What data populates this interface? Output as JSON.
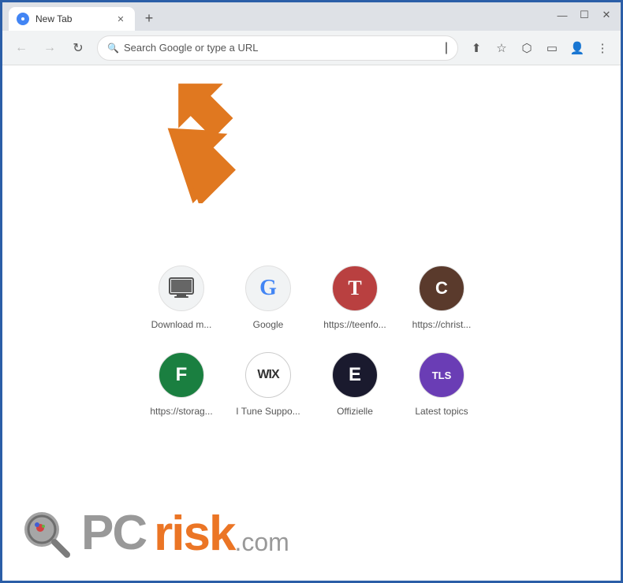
{
  "browser": {
    "tab_label": "New Tab",
    "new_tab_icon": "+",
    "window_controls": {
      "minimize": "—",
      "maximize": "☐",
      "close": "✕"
    }
  },
  "toolbar": {
    "back_label": "←",
    "forward_label": "→",
    "reload_label": "↻",
    "address_placeholder": "Search Google or type a URL",
    "share_icon": "⬆",
    "bookmark_icon": "☆",
    "extensions_icon": "⬡",
    "cast_icon": "▭",
    "profile_icon": "👤",
    "menu_icon": "⋮"
  },
  "shortcuts": [
    {
      "id": "download",
      "label": "Download m...",
      "icon_type": "monitor",
      "bg": "f1f3f4",
      "icon_color": "444"
    },
    {
      "id": "google",
      "label": "Google",
      "icon_type": "google",
      "bg": "f1f3f4",
      "icon_color": "4285f4"
    },
    {
      "id": "teenfo",
      "label": "https://teenfo...",
      "icon_type": "T",
      "bg": "b94040",
      "icon_color": "ffffff"
    },
    {
      "id": "christ",
      "label": "https://christ...",
      "icon_type": "C",
      "bg": "5a3a2c",
      "icon_color": "ffffff"
    },
    {
      "id": "storage",
      "label": "https://storag...",
      "icon_type": "F",
      "bg": "1a7f40",
      "icon_color": "ffffff"
    },
    {
      "id": "wix",
      "label": "I Tune Suppo...",
      "icon_type": "wix",
      "bg": "ffffff",
      "icon_color": "333333"
    },
    {
      "id": "offizielle",
      "label": "Offizielle",
      "icon_type": "E",
      "bg": "1a1a2e",
      "icon_color": "ffffff"
    },
    {
      "id": "latest",
      "label": "Latest topics",
      "icon_type": "TLS",
      "bg": "6a3db5",
      "icon_color": "ffffff"
    }
  ],
  "watermark": {
    "pc": "PC",
    "risk": "risk",
    "dotcom": ".com"
  }
}
